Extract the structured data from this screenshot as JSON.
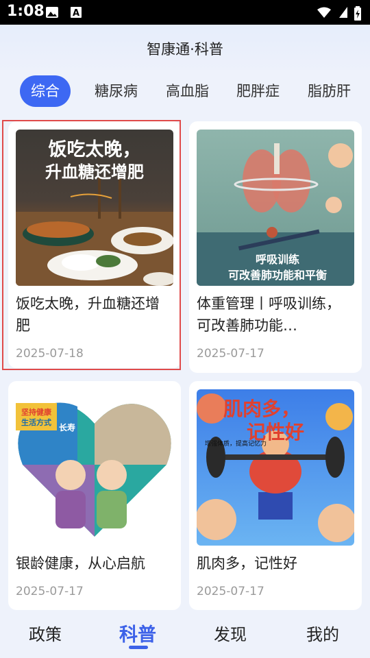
{
  "status": {
    "time": "1:08"
  },
  "app": {
    "title": "智康通·科普"
  },
  "tabs": [
    {
      "label": "综合",
      "active": true
    },
    {
      "label": "糖尿病"
    },
    {
      "label": "高血脂"
    },
    {
      "label": "肥胖症"
    },
    {
      "label": "脂肪肝"
    }
  ],
  "cards": [
    {
      "image_text": [
        "饭吃太晚，",
        "升血糖还增肥"
      ],
      "title": "饭吃太晚，升血糖还增肥",
      "date": "2025-07-18"
    },
    {
      "image_text": [
        "呼吸训练",
        "可改善肺功能和平衡"
      ],
      "title": "体重管理丨呼吸训练，可改善肺功能…",
      "date": "2025-07-17"
    },
    {
      "image_text": [
        "坚持健康",
        "生活方式",
        "长寿"
      ],
      "title": "银龄健康，从心启航",
      "date": "2025-07-17"
    },
    {
      "image_text": [
        "肌肉多，",
        "记性好",
        "增强体质，提高记忆力"
      ],
      "title": "肌肉多，记性好",
      "date": "2025-07-17"
    }
  ],
  "bottom_nav": [
    {
      "label": "政策"
    },
    {
      "label": "科普",
      "active": true
    },
    {
      "label": "发现"
    },
    {
      "label": "我的"
    }
  ],
  "colors": {
    "accent": "#3d68f3",
    "selection": "#e04a4a"
  }
}
